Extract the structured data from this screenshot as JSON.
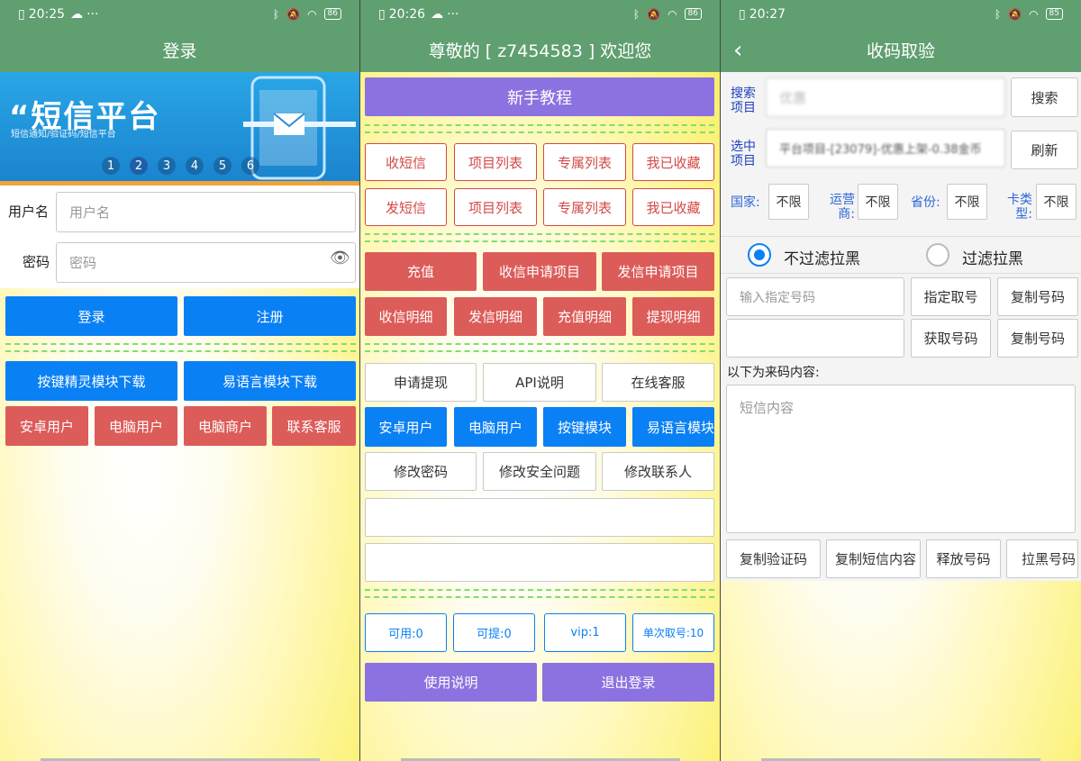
{
  "screen1": {
    "status": {
      "time": "20:25",
      "dots": "···",
      "battery": "86"
    },
    "title": "登录",
    "banner": {
      "title": "“短信平台",
      "subtitle": "短信通知/验证码/短信平台",
      "dots": [
        "1",
        "2",
        "3",
        "4",
        "5",
        "6"
      ],
      "active": 2
    },
    "username": {
      "label": "用户名",
      "placeholder": "用户名"
    },
    "password": {
      "label": "密码",
      "placeholder": "密码"
    },
    "login": "登录",
    "register": "注册",
    "dl_ajjl": "按键精灵模块下载",
    "dl_yyy": "易语言模块下载",
    "android": "安卓用户",
    "pc": "电脑用户",
    "merchant": "电脑商户",
    "contact": "联系客服"
  },
  "screen2": {
    "status": {
      "time": "20:26",
      "dots": "···",
      "battery": "86"
    },
    "title": "尊敬的 [ z7454583 ] 欢迎您",
    "tutorial": "新手教程",
    "row1": [
      "收短信",
      "项目列表",
      "专属列表",
      "我已收藏"
    ],
    "row2": [
      "发短信",
      "项目列表",
      "专属列表",
      "我已收藏"
    ],
    "row3": [
      "充值",
      "收信申请项目",
      "发信申请项目"
    ],
    "row4": [
      "收信明细",
      "发信明细",
      "充值明细",
      "提现明细"
    ],
    "row5": [
      "申请提现",
      "API说明",
      "在线客服"
    ],
    "row6": [
      "安卓用户",
      "电脑用户",
      "按键模块",
      "易语言模块"
    ],
    "row7": [
      "修改密码",
      "修改安全问题",
      "修改联系人"
    ],
    "stats": [
      "可用:0",
      "可提:0",
      "vip:1",
      "单次取号:10"
    ],
    "usage": "使用说明",
    "logout": "退出登录"
  },
  "screen3": {
    "status": {
      "time": "20:27",
      "battery": "85"
    },
    "title": "收码取验",
    "search_label": "搜索项目",
    "search_value": "优惠",
    "search_btn": "搜索",
    "selected_label": "选中项目",
    "selected_value": "平台项目-[23079]-优惠上架-0.38金币",
    "refresh_btn": "刷新",
    "filters": [
      {
        "label": "国家:",
        "value": "不限"
      },
      {
        "label": "运营商:",
        "value": "不限"
      },
      {
        "label": "省份:",
        "value": "不限"
      },
      {
        "label": "卡类型:",
        "value": "不限"
      }
    ],
    "radio_nofilter": "不过滤拉黑",
    "radio_filter": "过滤拉黑",
    "phone_placeholder": "输入指定号码",
    "specify_btn": "指定取号",
    "copy_btn1": "复制号码",
    "get_btn": "获取号码",
    "copy_btn2": "复制号码",
    "content_label": "以下为来码内容:",
    "content_placeholder": "短信内容",
    "copy_code": "复制验证码",
    "copy_sms": "复制短信内容",
    "release": "释放号码",
    "blacklist": "拉黑号码"
  }
}
